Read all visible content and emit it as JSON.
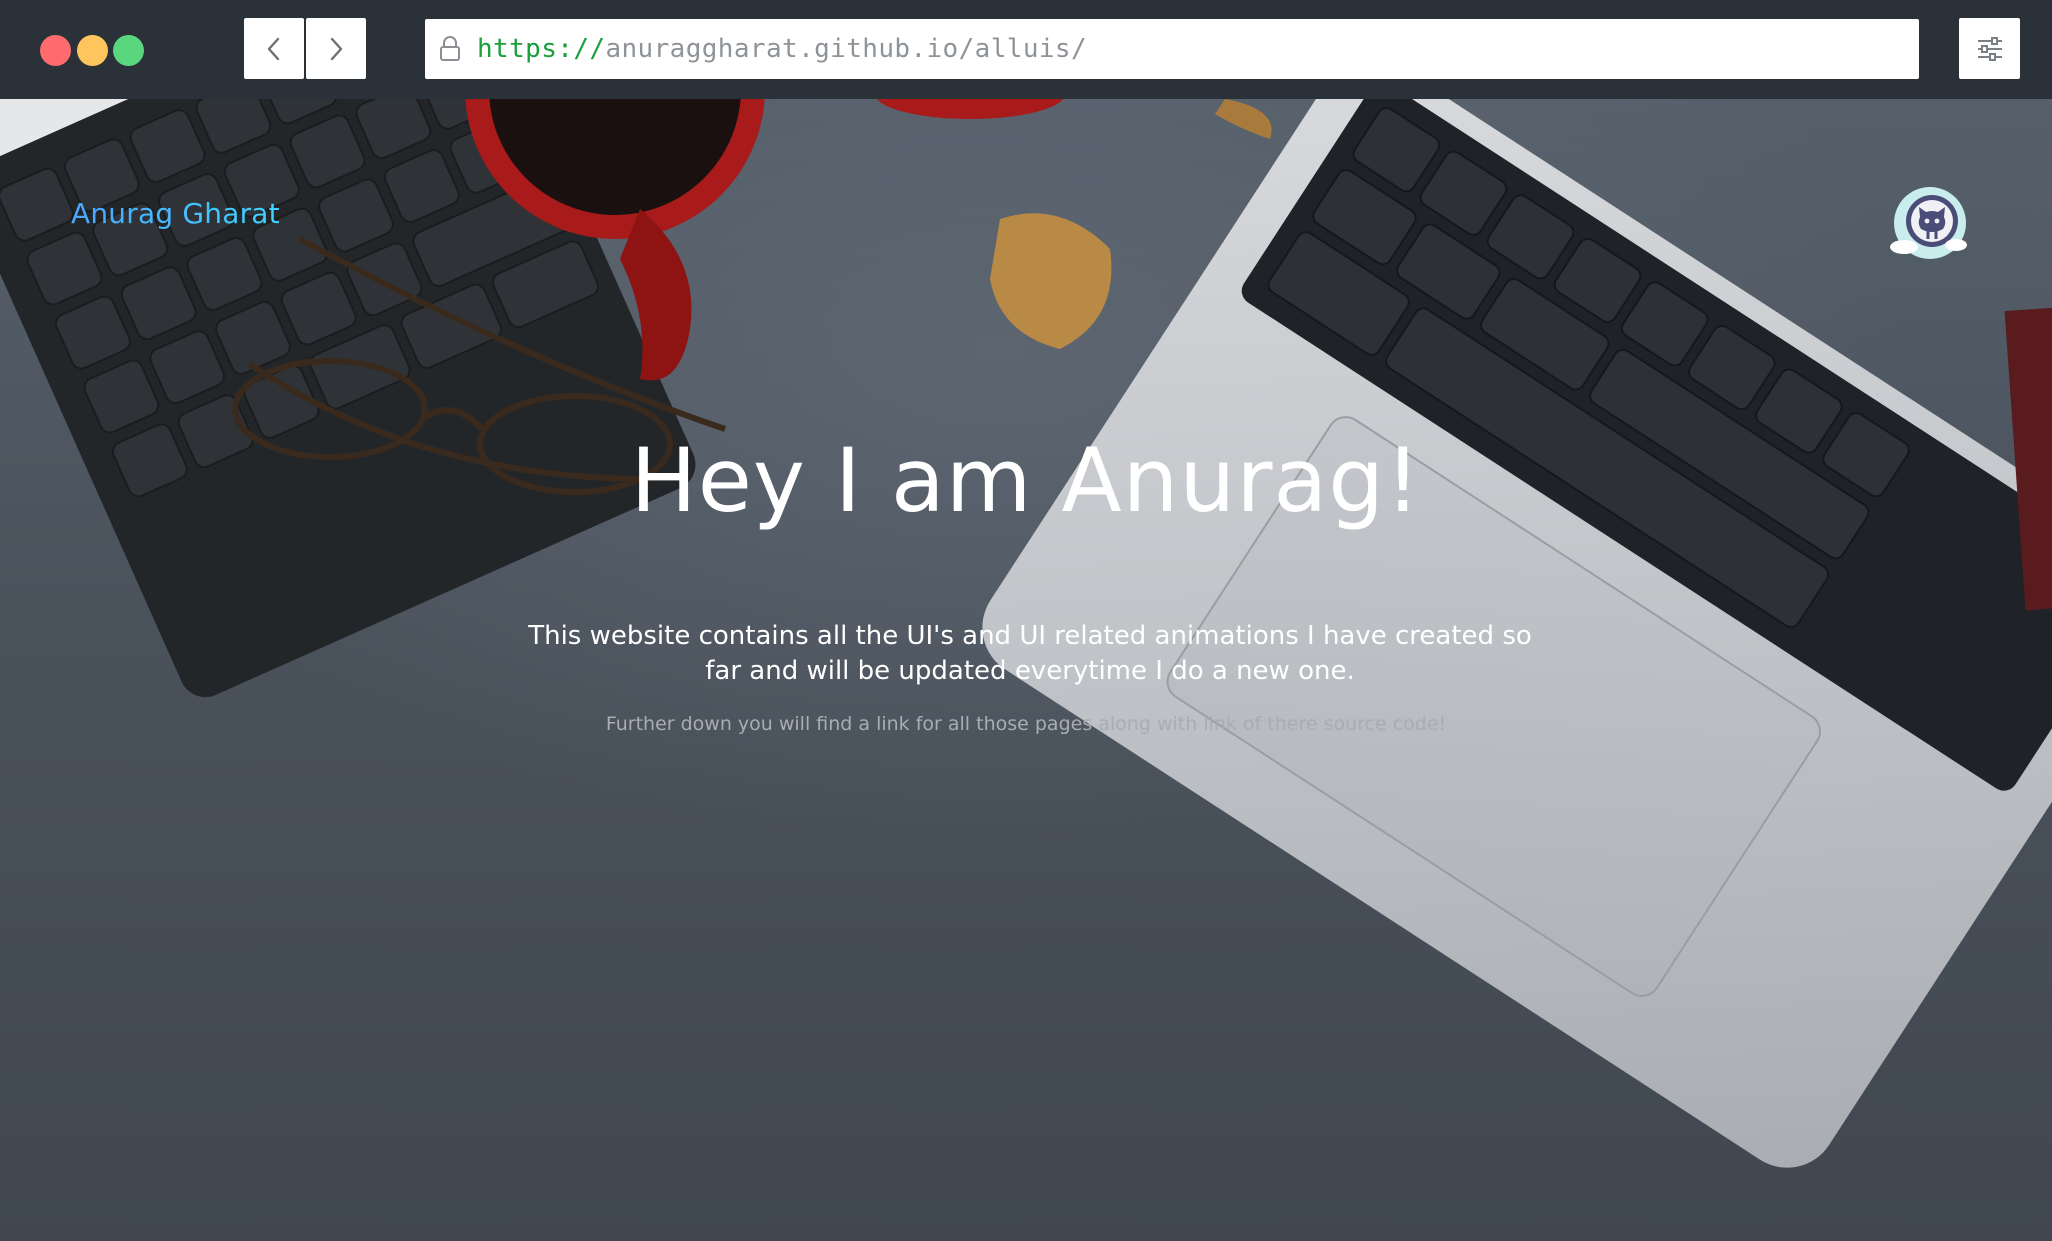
{
  "browser": {
    "url_protocol": "https://",
    "url_rest": "anuraggharat.github.io/alluis/",
    "back_icon": "chevron-left-icon",
    "forward_icon": "chevron-right-icon",
    "lock_icon": "lock-icon",
    "menu_icon": "sliders-icon",
    "traffic_lights": {
      "close": "#fe6b6e",
      "minimize": "#fdc55c",
      "maximize": "#5ad67f"
    }
  },
  "page": {
    "brand": "Anurag Gharat",
    "github_icon": "github-octocat-icon",
    "hero_title": "Hey I am Anurag!",
    "hero_subtitle": "This website contains all the UI's and UI related animations I have created so far and will be updated everytime I do a new one.",
    "hero_note": "Further down you will find a link for all those pages along with link of there source code!"
  },
  "colors": {
    "chrome_bg": "#2a3139",
    "url_protocol": "#1aa03a",
    "brand_gradient_start": "#4aa6ff",
    "brand_gradient_end": "#3fd5ff"
  }
}
